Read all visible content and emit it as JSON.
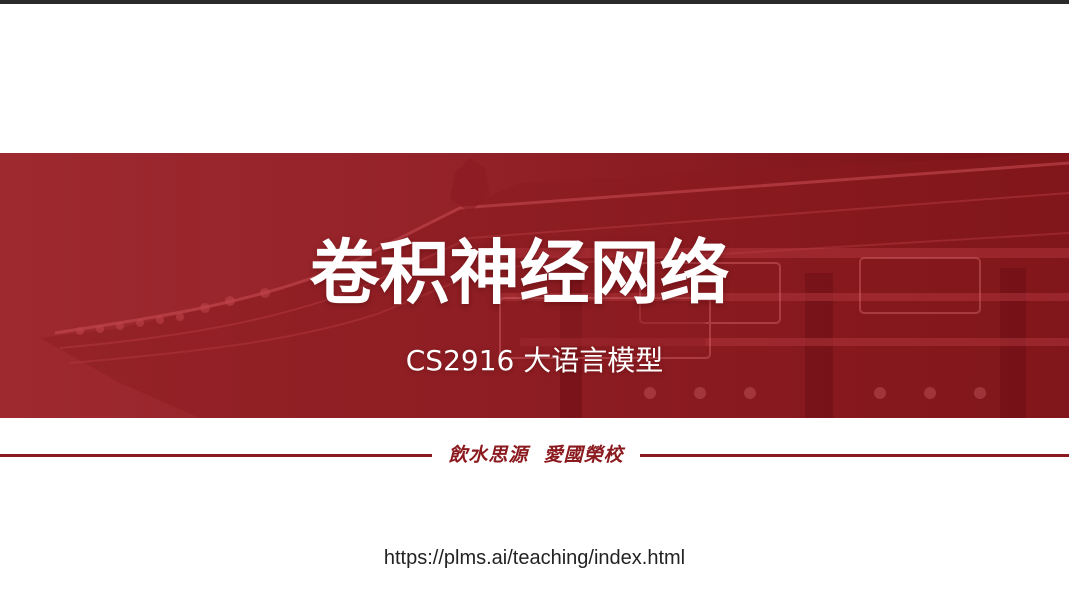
{
  "slide": {
    "title": "卷积神经网络",
    "subtitle": "CS2916 大语言模型",
    "motto": "飲水思源  愛國榮校",
    "url": "https://plms.ai/teaching/index.html"
  },
  "colors": {
    "banner_red": "#a02a30",
    "motto_red": "#8b1a1f",
    "top_bar": "#2b2b2b"
  },
  "icons": {
    "banner_image": "traditional-gate-roof-illustration"
  }
}
